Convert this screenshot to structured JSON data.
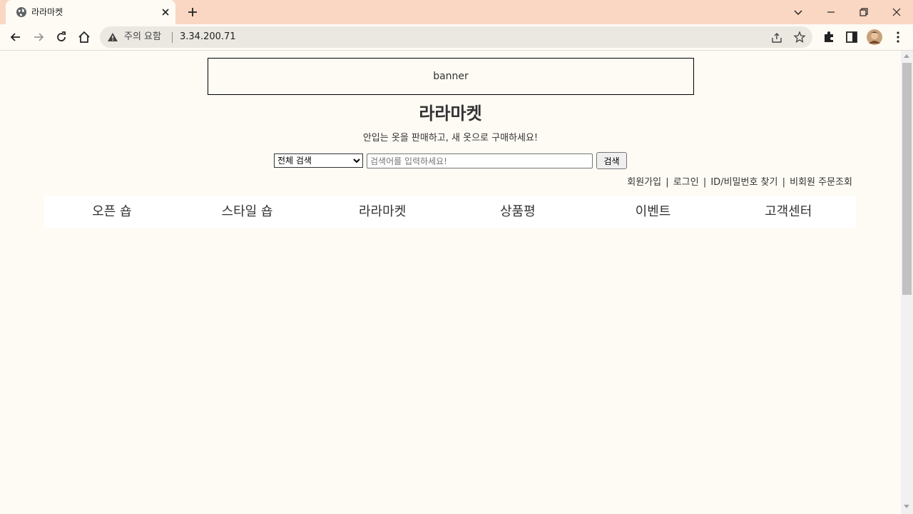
{
  "browser": {
    "tab": {
      "title": "라라마켓"
    },
    "omnibox": {
      "security_label": "주의 요함",
      "url": "3.34.200.71"
    }
  },
  "page": {
    "banner": "banner",
    "title": "라라마켓",
    "tagline": "안입는 옷을 판매하고, 새 옷으로 구매하세요!",
    "search": {
      "selected_option": "전체 검색",
      "placeholder": "검색어를 입력하세요!",
      "button_label": "검색"
    },
    "account_links": {
      "signup": "회원가입",
      "login": "로그인",
      "find_id_password": "ID/비밀번호 찾기",
      "guest_order": "비회원 주문조회",
      "separator": "|"
    },
    "nav": [
      {
        "label": "오픈 숍"
      },
      {
        "label": "스타일 숍"
      },
      {
        "label": "라라마켓"
      },
      {
        "label": "상품평"
      },
      {
        "label": "이벤트"
      },
      {
        "label": "고객센터"
      }
    ]
  }
}
